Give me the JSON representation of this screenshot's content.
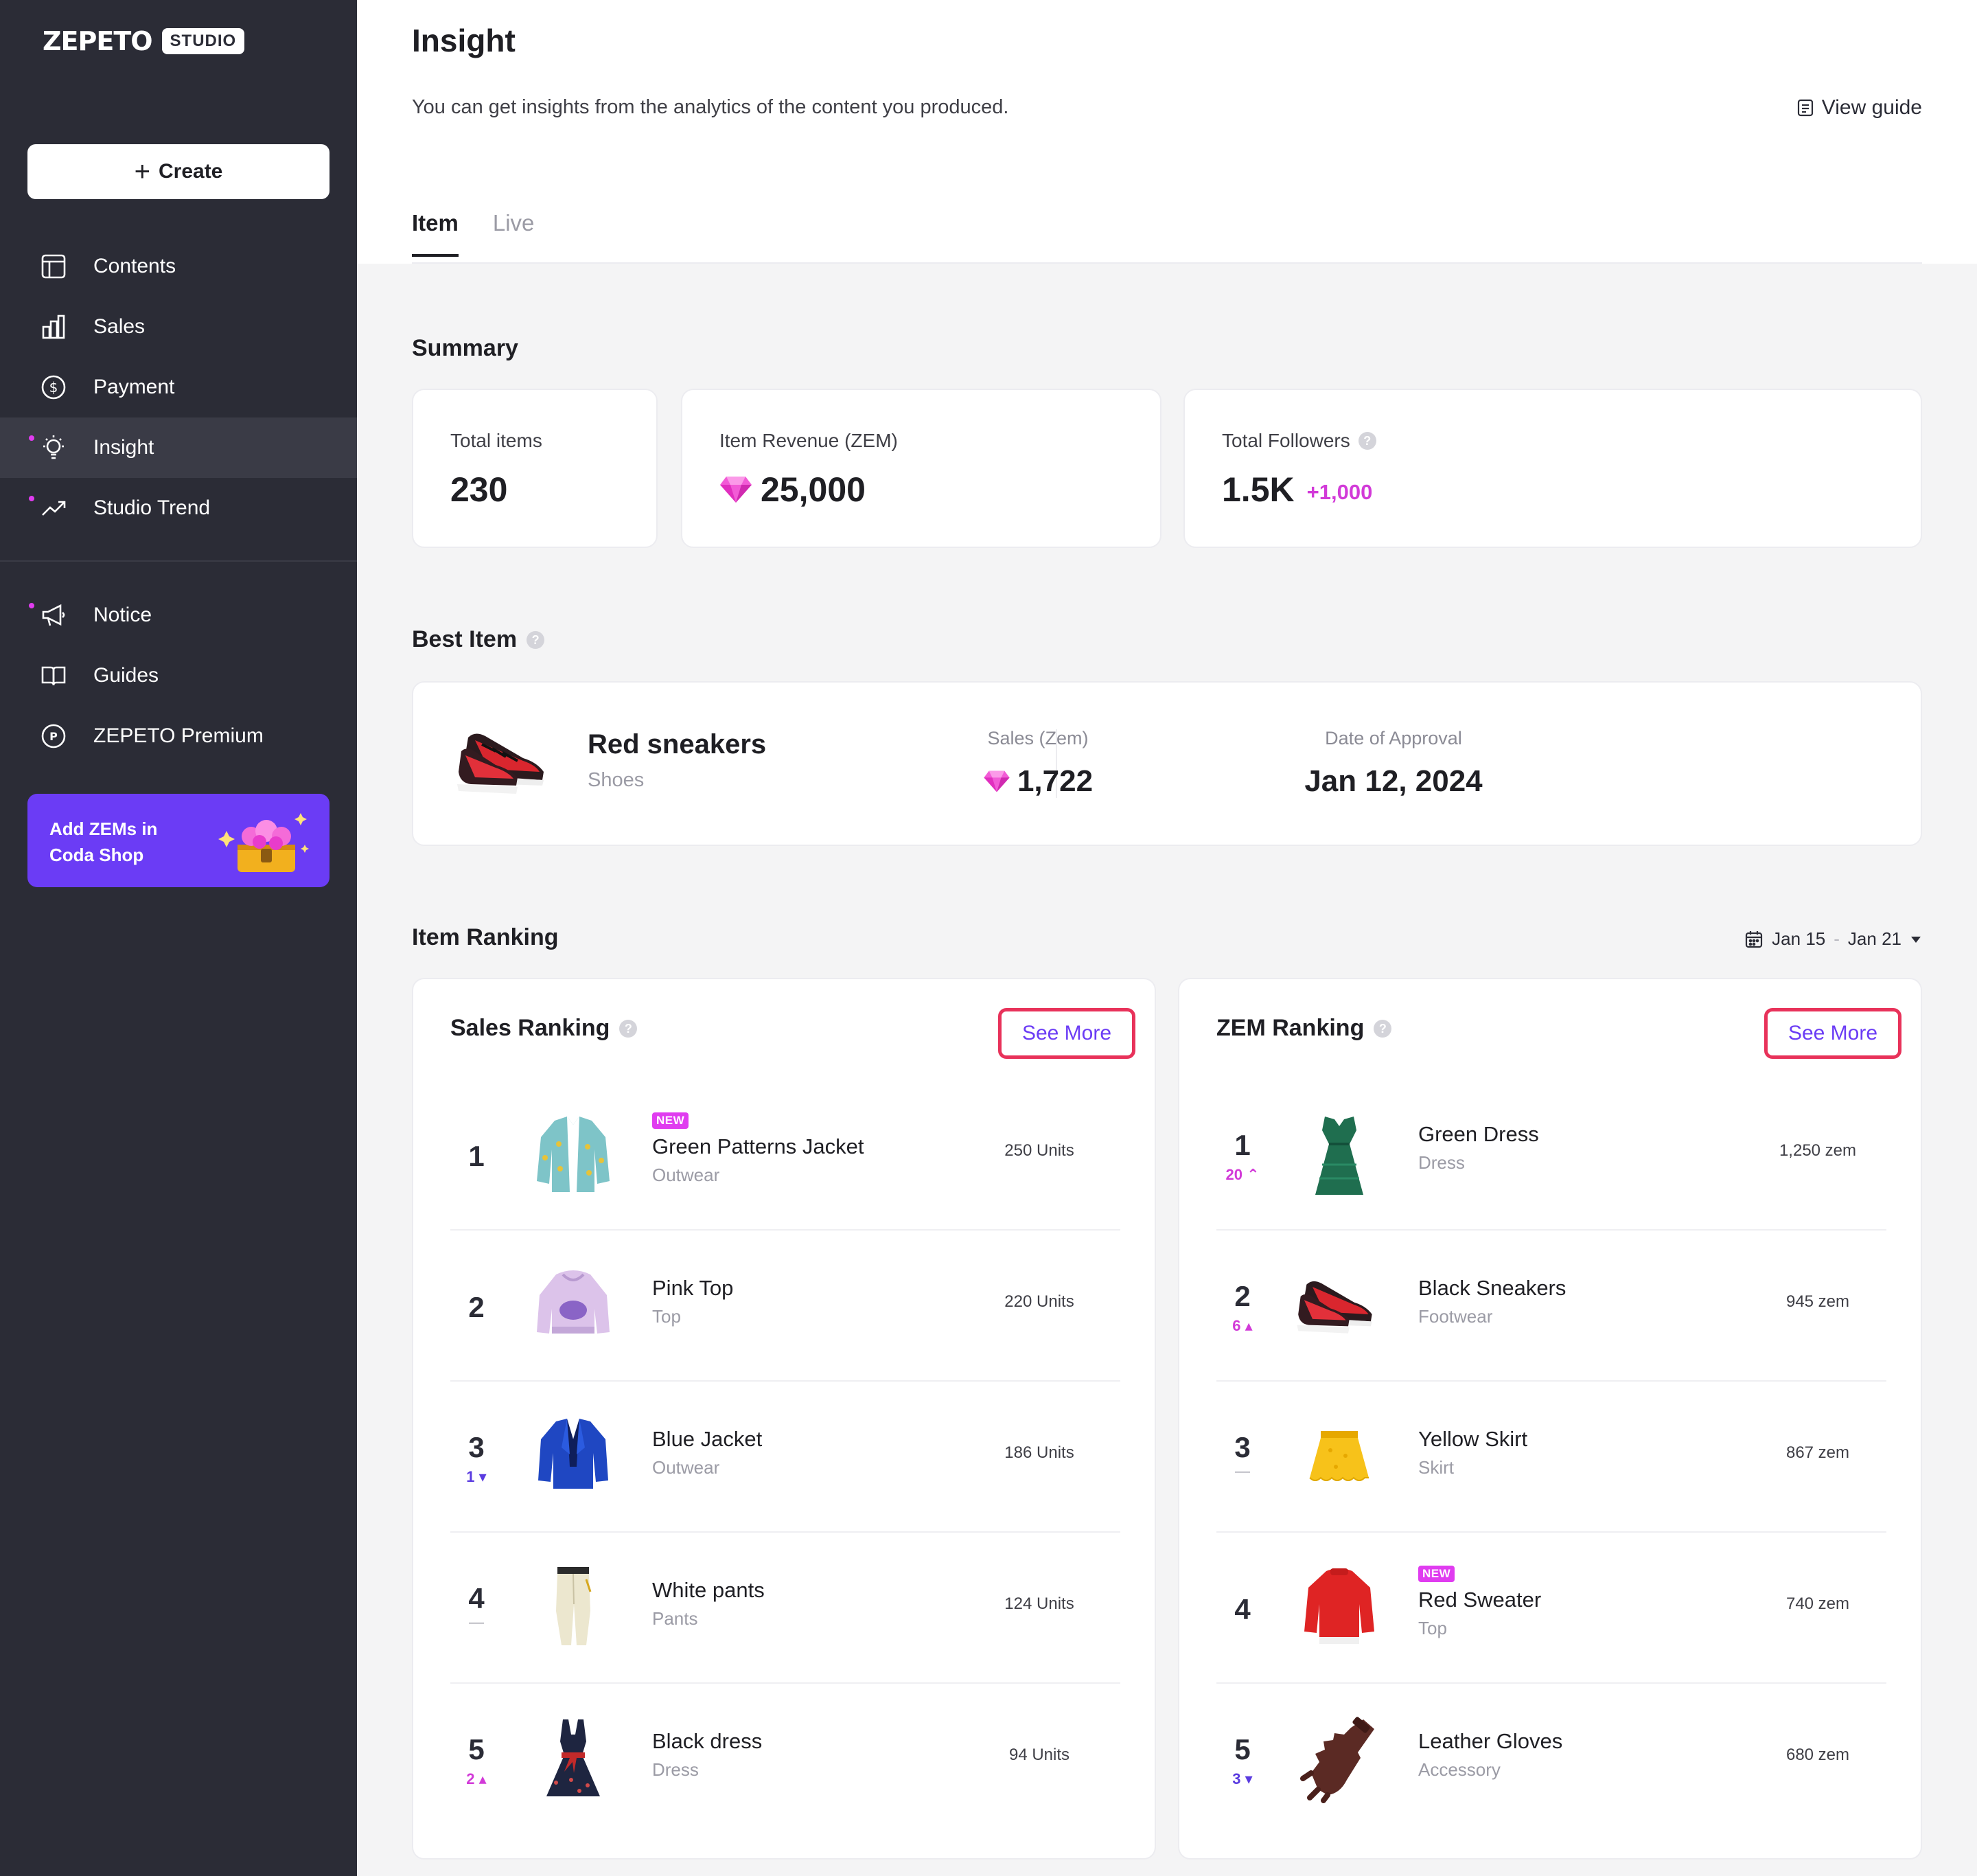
{
  "brand": {
    "logo": "ZEPETO",
    "badge": "STUDIO"
  },
  "sidebar": {
    "create_label": "Create",
    "items": [
      {
        "label": "Contents",
        "icon": "layout-icon"
      },
      {
        "label": "Sales",
        "icon": "bar-chart-icon"
      },
      {
        "label": "Payment",
        "icon": "dollar-icon"
      },
      {
        "label": "Insight",
        "icon": "lightbulb-icon"
      },
      {
        "label": "Studio Trend",
        "icon": "trend-icon"
      },
      {
        "label": "Notice",
        "icon": "megaphone-icon"
      },
      {
        "label": "Guides",
        "icon": "book-icon"
      },
      {
        "label": "ZEPETO Premium",
        "icon": "premium-icon"
      }
    ],
    "promo_line1": "Add ZEMs in",
    "promo_line2": "Coda Shop"
  },
  "header": {
    "title": "Insight",
    "description": "You can get insights from the analytics of the content you produced.",
    "view_guide": "View guide",
    "tabs": [
      "Item",
      "Live"
    ]
  },
  "summary": {
    "title": "Summary",
    "total_items_label": "Total items",
    "total_items_value": "230",
    "revenue_label": "Item Revenue (ZEM)",
    "revenue_value": "25,000",
    "followers_label": "Total Followers",
    "followers_value": "1.5K",
    "followers_delta": "+1,000"
  },
  "best_item": {
    "title": "Best Item",
    "name": "Red sneakers",
    "category": "Shoes",
    "sales_label": "Sales (Zem)",
    "sales_value": "1,722",
    "approval_label": "Date of Approval",
    "approval_value": "Jan 12, 2024"
  },
  "ranking": {
    "title": "Item Ranking",
    "date_start": "Jan 15",
    "date_sep": "-",
    "date_end": "Jan 21",
    "see_more": "See More",
    "sales": {
      "title": "Sales Ranking",
      "rows": [
        {
          "rank": "1",
          "change": "",
          "name": "Green Patterns Jacket",
          "category": "Outwear",
          "value": "250 Units",
          "new": "NEW"
        },
        {
          "rank": "2",
          "change": "",
          "name": "Pink Top",
          "category": "Top",
          "value": "220 Units"
        },
        {
          "rank": "3",
          "change": "1 ▾",
          "name": "Blue Jacket",
          "category": "Outwear",
          "value": "186 Units"
        },
        {
          "rank": "4",
          "change": "—",
          "name": "White pants",
          "category": "Pants",
          "value": "124 Units"
        },
        {
          "rank": "5",
          "change": "2 ▴",
          "name": "Black dress",
          "category": "Dress",
          "value": "94 Units"
        }
      ]
    },
    "zem": {
      "title": "ZEM Ranking",
      "rows": [
        {
          "rank": "1",
          "change": "20 ⌃",
          "name": "Green Dress",
          "category": "Dress",
          "value": "1,250 zem"
        },
        {
          "rank": "2",
          "change": "6 ▴",
          "name": "Black Sneakers",
          "category": "Footwear",
          "value": "945 zem"
        },
        {
          "rank": "3",
          "change": "—",
          "name": "Yellow Skirt",
          "category": "Skirt",
          "value": "867 zem"
        },
        {
          "rank": "4",
          "change": "",
          "name": "Red Sweater",
          "category": "Top",
          "value": "740 zem",
          "new": "NEW"
        },
        {
          "rank": "5",
          "change": "3 ▾",
          "name": "Leather Gloves",
          "category": "Accessory",
          "value": "680 zem"
        }
      ]
    }
  },
  "colors": {
    "sidebar": "#2b2c36",
    "accent_purple": "#6b3cf5",
    "accent_pink": "#d23ad8",
    "highlight_red": "#e8325a"
  }
}
